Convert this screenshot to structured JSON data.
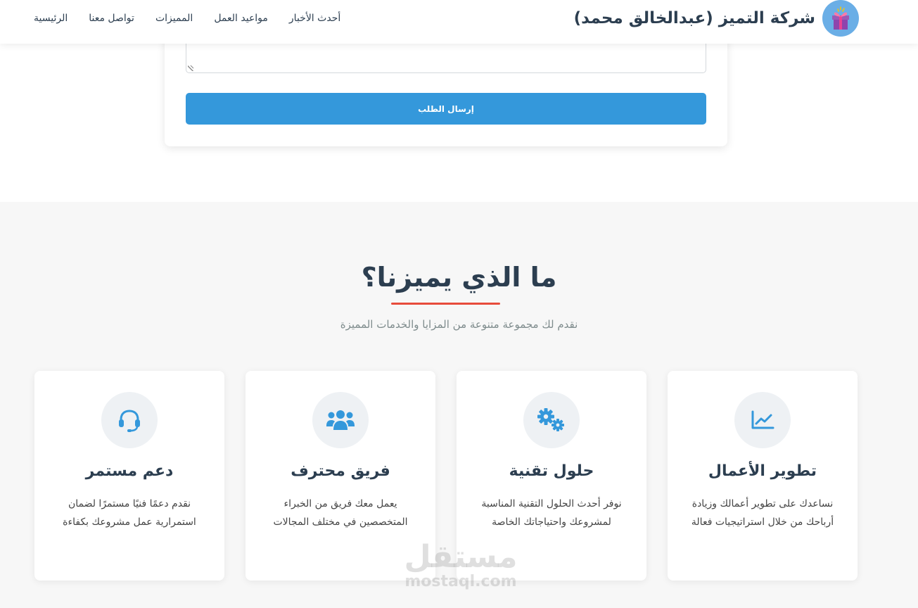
{
  "header": {
    "brand_name": "شركة التميز (عبدالخالق محمد)",
    "nav": [
      "الرئيسية",
      "تواصل معنا",
      "المميزات",
      "مواعيد العمل",
      "أحدث الأخبار"
    ]
  },
  "form": {
    "submit_label": "إرسال الطلب"
  },
  "features": {
    "title": "ما الذي يميزنا؟",
    "subtitle": "نقدم لك مجموعة متنوعة من المزايا والخدمات المميزة",
    "cards": [
      {
        "icon": "chart-line-icon",
        "title": "تطوير الأعمال",
        "desc": "نساعدك على تطوير أعمالك وزيادة أرباحك من خلال استراتيجيات فعالة"
      },
      {
        "icon": "cogs-icon",
        "title": "حلول تقنية",
        "desc": "نوفر أحدث الحلول التقنية المناسبة لمشروعك واحتياجاتك الخاصة"
      },
      {
        "icon": "users-icon",
        "title": "فريق محترف",
        "desc": "يعمل معك فريق من الخبراء المتخصصين في مختلف المجالات"
      },
      {
        "icon": "headset-icon",
        "title": "دعم مستمر",
        "desc": "نقدم دعمًا فنيًا مستمرًا لضمان استمرارية عمل مشروعك بكفاءة"
      }
    ]
  },
  "watermark": {
    "arabic": "مستقل",
    "latin": "mostaql.com"
  },
  "colors": {
    "accent": "#3498db",
    "underline": "#e74c3c",
    "heading": "#2c3e50",
    "section_bg": "#f7f7f7"
  }
}
